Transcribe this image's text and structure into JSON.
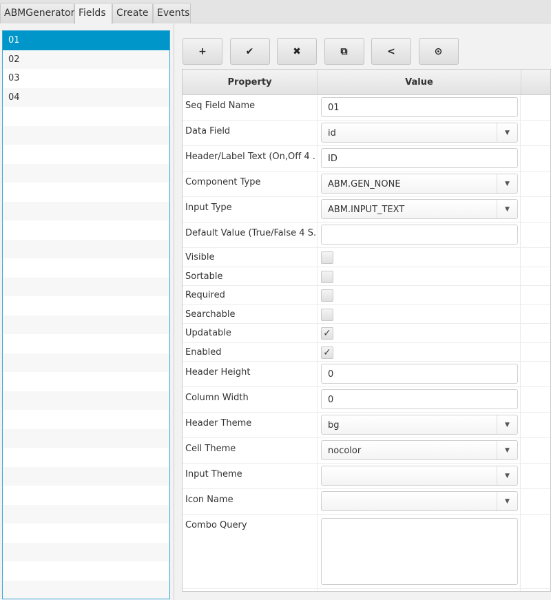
{
  "tabs": [
    "ABMGenerator",
    "Fields",
    "Create",
    "Events"
  ],
  "active_tab": "Fields",
  "fields_list": [
    "01",
    "02",
    "03",
    "04"
  ],
  "selected_field": "01",
  "toolbar": [
    {
      "icon": "plus-icon",
      "glyph": "+"
    },
    {
      "icon": "check-icon",
      "glyph": "✔"
    },
    {
      "icon": "close-icon",
      "glyph": "✖"
    },
    {
      "icon": "copy-icon",
      "glyph": "⧉"
    },
    {
      "icon": "share-icon",
      "glyph": "<"
    },
    {
      "icon": "upload-circle-icon",
      "glyph": "⊙"
    }
  ],
  "table": {
    "headers": [
      "Property",
      "Value"
    ],
    "rows": [
      {
        "label": "Seq Field Name",
        "type": "text",
        "value": "01"
      },
      {
        "label": "Data Field",
        "type": "combo",
        "value": "id"
      },
      {
        "label": "Header/Label Text (On,Off 4 ...",
        "type": "text",
        "value": "ID"
      },
      {
        "label": "Component Type",
        "type": "combo",
        "value": "ABM.GEN_NONE"
      },
      {
        "label": "Input Type",
        "type": "combo",
        "value": "ABM.INPUT_TEXT"
      },
      {
        "label": "Default Value (True/False 4 S...",
        "type": "text",
        "value": ""
      },
      {
        "label": "Visible",
        "type": "check",
        "checked": false
      },
      {
        "label": "Sortable",
        "type": "check",
        "checked": false
      },
      {
        "label": "Required",
        "type": "check",
        "checked": false
      },
      {
        "label": "Searchable",
        "type": "check",
        "checked": false
      },
      {
        "label": "Updatable",
        "type": "check",
        "checked": true
      },
      {
        "label": "Enabled",
        "type": "check",
        "checked": true
      },
      {
        "label": "Header Height",
        "type": "text",
        "value": "0"
      },
      {
        "label": "Column Width",
        "type": "text",
        "value": "0"
      },
      {
        "label": "Header Theme",
        "type": "combo",
        "value": "bg"
      },
      {
        "label": "Cell Theme",
        "type": "combo",
        "value": "nocolor"
      },
      {
        "label": "Input Theme",
        "type": "combo",
        "value": ""
      },
      {
        "label": "Icon Name",
        "type": "combo",
        "value": ""
      },
      {
        "label": "Combo Query",
        "type": "textarea",
        "value": ""
      }
    ]
  },
  "colors": {
    "selection": "#0096c9",
    "list_border": "#3aa7d6"
  }
}
